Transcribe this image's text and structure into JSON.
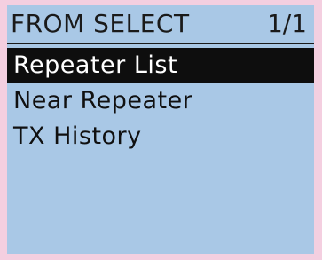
{
  "header": {
    "title": "FROM SELECT",
    "page": "1/1"
  },
  "menu": {
    "items": [
      {
        "label": "Repeater List",
        "selected": true
      },
      {
        "label": "Near Repeater",
        "selected": false
      },
      {
        "label": "TX History",
        "selected": false
      }
    ]
  },
  "colors": {
    "frame": "#f4cfe0",
    "screen": "#a9c8e6",
    "text": "#101010",
    "highlight_bg": "#0e0e0e",
    "highlight_text": "#ffffff"
  }
}
